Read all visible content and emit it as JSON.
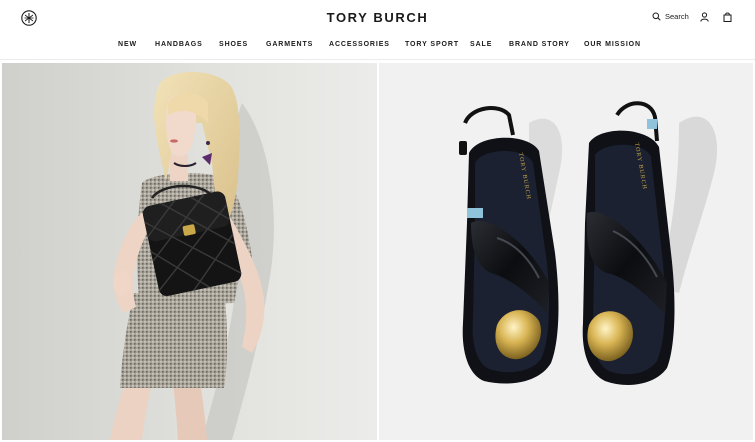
{
  "header": {
    "brand": "TORY BURCH",
    "logo_icon": "tory-burch-monogram-icon",
    "search_label": "Search",
    "search_icon": "search-icon",
    "account_icon": "user-icon",
    "bag_icon": "shopping-bag-icon"
  },
  "nav": {
    "items": [
      {
        "label": "NEW"
      },
      {
        "label": "HANDBAGS"
      },
      {
        "label": "SHOES"
      },
      {
        "label": "GARMENTS"
      },
      {
        "label": "ACCESSORIES"
      },
      {
        "label": "TORY SPORT"
      },
      {
        "label": "SALE"
      },
      {
        "label": "BRAND STORY"
      },
      {
        "label": "OUR MISSION"
      }
    ]
  },
  "hero": {
    "left_image": "model-with-black-quilted-bag-image",
    "right_image": "black-patent-sandals-image",
    "insole_text": "TORY BURCH"
  },
  "colors": {
    "text": "#1a1a1a",
    "background": "#ffffff",
    "patent_black": "#111318",
    "gold": "#c9a84a",
    "strap_blue": "#8fc3dc"
  }
}
